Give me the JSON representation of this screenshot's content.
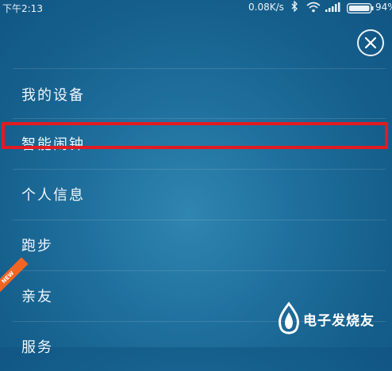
{
  "status_bar": {
    "time": "下午2:13",
    "net_speed": "0.08K/s",
    "battery": "94%",
    "icons": [
      "bluetooth-icon",
      "wifi-icon",
      "signal-icon",
      "battery-icon"
    ]
  },
  "menu": {
    "items": [
      {
        "label": "我的设备"
      },
      {
        "label": "智能闹钟",
        "highlighted": true
      },
      {
        "label": "个人信息"
      },
      {
        "label": "跑步"
      },
      {
        "label": "亲友",
        "badge": "NEW"
      },
      {
        "label": "服务"
      }
    ]
  },
  "watermark": {
    "text": "电子发烧友"
  },
  "colors": {
    "background": "#1a6a98",
    "highlight_border": "#e21b21",
    "new_badge": "#f26522"
  }
}
